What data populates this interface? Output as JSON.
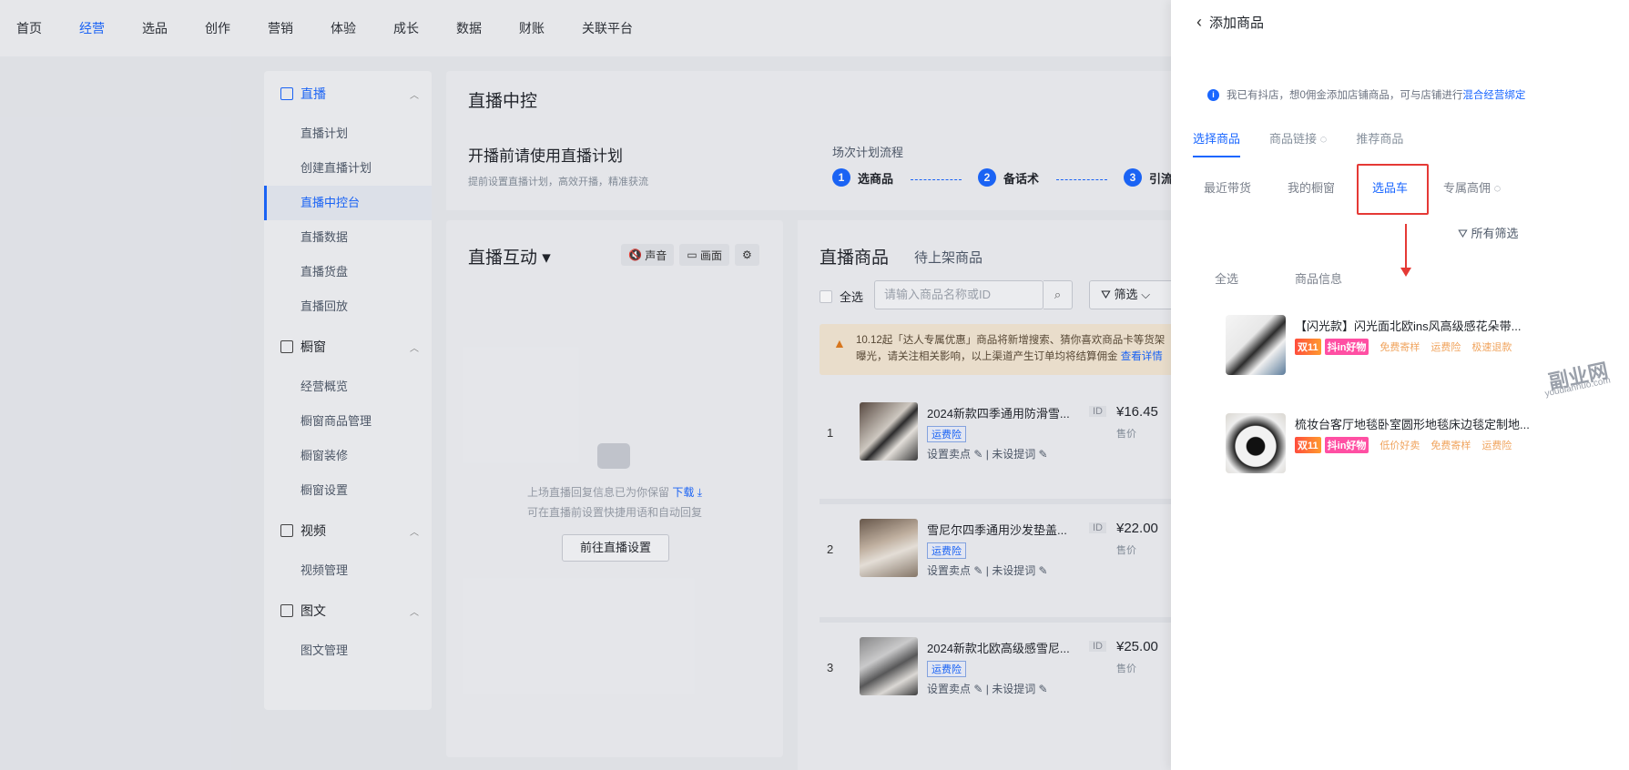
{
  "topnav": [
    "首页",
    "经营",
    "选品",
    "创作",
    "营销",
    "体验",
    "成长",
    "数据",
    "财账",
    "关联平台"
  ],
  "sidebar": {
    "groups": [
      {
        "title": "直播",
        "items": [
          "直播计划",
          "创建直播计划",
          "直播中控台",
          "直播数据",
          "直播货盘",
          "直播回放"
        ]
      },
      {
        "title": "橱窗",
        "items": [
          "经营概览",
          "橱窗商品管理",
          "橱窗装修",
          "橱窗设置"
        ]
      },
      {
        "title": "视频",
        "items": [
          "视频管理"
        ]
      },
      {
        "title": "图文",
        "items": [
          "图文管理"
        ]
      }
    ]
  },
  "main": {
    "title": "直播中控",
    "plan_title": "开播前请使用直播计划",
    "plan_sub": "提前设置直播计划，高效开播，精准获流",
    "flow_title": "场次计划流程",
    "flow_steps": [
      {
        "num": "1",
        "label": "选商品"
      },
      {
        "num": "2",
        "label": "备话术"
      },
      {
        "num": "3",
        "label": "引流"
      }
    ]
  },
  "interact": {
    "title": "直播互动",
    "sound_btn": "声音",
    "screen_btn": "画面",
    "empty_text1": "上场直播回复信息已为你保留",
    "download": "下载",
    "empty_text2": "可在直播前设置快捷用语和自动回复",
    "goto_btn": "前往直播设置"
  },
  "goods": {
    "title": "直播商品",
    "tab2": "待上架商品",
    "select_all": "全选",
    "search_placeholder": "请输入商品名称或ID",
    "filter": "筛选",
    "notice_line1": "10.12起「达人专属优惠」商品将新增搜索、猜你喜欢商品卡等货架",
    "notice_line2": "曝光，请关注相关影响，以上渠道产生订单均将结算佣金",
    "notice_link": "查看详情",
    "rows": [
      {
        "idx": "1",
        "name": "2024新款四季通用防滑雪...",
        "tag": "运费险",
        "price": "¥16.45",
        "price_label": "售价",
        "op1": "设置卖点",
        "op2": "未设提词",
        "id": "ID"
      },
      {
        "idx": "2",
        "name": "雪尼尔四季通用沙发垫盖...",
        "tag": "运费险",
        "price": "¥22.00",
        "price_label": "售价",
        "op1": "设置卖点",
        "op2": "未设提词",
        "id": "ID"
      },
      {
        "idx": "3",
        "name": "2024新款北欧高级感雪尼...",
        "tag": "运费险",
        "price": "¥25.00",
        "price_label": "售价",
        "op1": "设置卖点",
        "op2": "未设提词",
        "id": "ID"
      }
    ]
  },
  "drawer": {
    "title": "添加商品",
    "info_text": "我已有抖店，想0佣金添加店铺商品，可与店铺进行",
    "info_link": "混合经营绑定",
    "tabs1": [
      "选择商品",
      "商品链接",
      "推荐商品"
    ],
    "tabs2": [
      "最近带货",
      "我的橱窗",
      "选品车",
      "专属高佣"
    ],
    "all_filter": "所有筛选",
    "list_head_select": "全选",
    "list_head_info": "商品信息",
    "products": [
      {
        "title": "【闪光款】闪光面北欧ins风高级感花朵带...",
        "badge1": "双11",
        "badge2": "抖in好物",
        "t1": "免费寄样",
        "t2": "运费险",
        "t3": "极速退款"
      },
      {
        "title": "梳妆台客厅地毯卧室圆形地毯床边毯定制地...",
        "badge1": "双11",
        "badge2": "抖in好物",
        "t1": "低价好卖",
        "t2": "免费寄样",
        "t3": "运费险"
      }
    ]
  },
  "watermark": {
    "main": "副业网",
    "sub": "youdianhuo.com"
  }
}
